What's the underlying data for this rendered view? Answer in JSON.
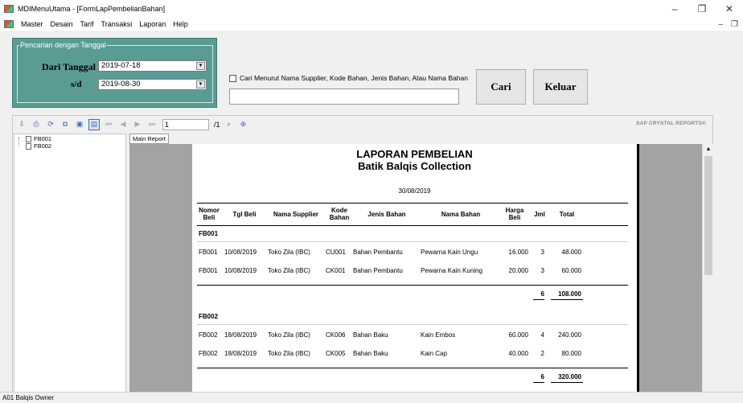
{
  "window": {
    "title": "MDIMenuUtama - [FormLapPembelianBahan]"
  },
  "menu": [
    "Master",
    "Desain",
    "Tarif",
    "Transaksi",
    "Laporan",
    "Help"
  ],
  "filter": {
    "group_label": "Pencarian dengan Tanggal",
    "dari_label": "Dari Tanggal",
    "sd_label": "s/d",
    "dari_value": "2019-07-18",
    "sd_value": "2019-08-30"
  },
  "search": {
    "checkbox_label": "Cari Menurut Nama Supplier, Kode Bahan, Jenis Bahan, Atau Nama Bahan",
    "text_value": ""
  },
  "buttons": {
    "cari": "Cari",
    "keluar": "Keluar"
  },
  "viewer": {
    "page_input": "1",
    "page_count": "/1",
    "brand": "SAP CRYSTAL REPORTS®",
    "tab_label": "Main Report"
  },
  "tree": [
    "FB001",
    "FB002"
  ],
  "report": {
    "title1": "LAPORAN PEMBELIAN",
    "title2": "Batik Balqis Collection",
    "date": "30/08/2019",
    "headers": {
      "nomor": "Nomor\nBeli",
      "tgl": "Tgl Beli",
      "supplier": "Nama Supplier",
      "kode": "Kode\nBahan",
      "jenis": "Jenis Bahan",
      "nama": "Nama Bahan",
      "harga": "Harga\nBeli",
      "jml": "Jml",
      "total": "Total"
    },
    "groups": [
      {
        "name": "FB001",
        "rows": [
          {
            "nomor": "FB001",
            "tgl": "10/08/2019",
            "supplier": "Toko Zila (IBC)",
            "kode": "CU001",
            "jenis": "Bahan Pembantu",
            "nama": "Pewarna Kain Ungu",
            "harga": "16.000",
            "jml": "3",
            "total": "48.000"
          },
          {
            "nomor": "FB001",
            "tgl": "10/08/2019",
            "supplier": "Toko Zila (IBC)",
            "kode": "CK001",
            "jenis": "Bahan Pembantu",
            "nama": "Pewarna Kain Kuning",
            "harga": "20.000",
            "jml": "3",
            "total": "60.000"
          }
        ],
        "sum_jml": "6",
        "sum_total": "108.000"
      },
      {
        "name": "FB002",
        "rows": [
          {
            "nomor": "FB002",
            "tgl": "18/08/2019",
            "supplier": "Toko Zila (IBC)",
            "kode": "CK006",
            "jenis": "Bahan Baku",
            "nama": "Kain Embos",
            "harga": "60.000",
            "jml": "4",
            "total": "240.000"
          },
          {
            "nomor": "FB002",
            "tgl": "18/08/2019",
            "supplier": "Toko Zila (IBC)",
            "kode": "CK005",
            "jenis": "Bahan Baku",
            "nama": "Kain Cap",
            "harga": "40.000",
            "jml": "2",
            "total": "80.000"
          }
        ],
        "sum_jml": "6",
        "sum_total": "320.000"
      }
    ]
  },
  "status": {
    "text": "A01  Balqis  Owner"
  },
  "colors": {
    "panel": "#5a9c94",
    "viewer_bg": "#a3a3a3"
  }
}
